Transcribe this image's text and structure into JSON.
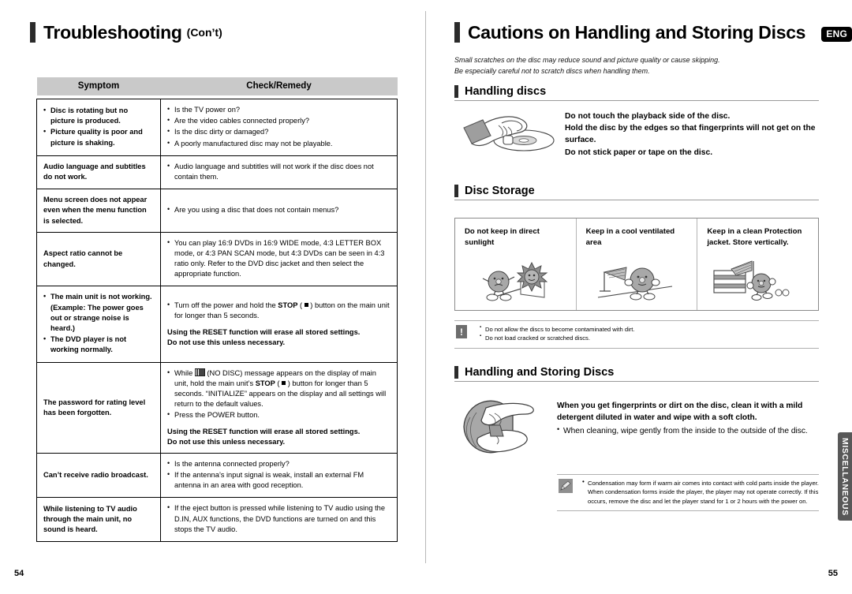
{
  "left_page": {
    "title": "Troubleshooting",
    "title_suffix": "(Con’t)",
    "page_number": "54",
    "table": {
      "headers": [
        "Symptom",
        "Check/Remedy"
      ],
      "rows": [
        {
          "symptom": [
            "Disc is rotating but no picture is produced.",
            "Picture quality is poor and picture is shaking."
          ],
          "remedy": [
            "Is the TV power on?",
            "Are the video cables connected properly?",
            "Is the disc dirty or damaged?",
            "A poorly manufactured disc may not be playable."
          ]
        },
        {
          "symptom_plain": "Audio language and subtitles do not work.",
          "remedy": [
            "Audio language and subtitles will not work if the disc does not contain them."
          ]
        },
        {
          "symptom_plain": "Menu screen does not appear even when the menu function is selected.",
          "remedy": [
            "Are you using a disc that does not contain menus?"
          ]
        },
        {
          "symptom_plain": "Aspect ratio cannot be changed.",
          "remedy": [
            "You can play 16:9 DVDs in 16:9 WIDE mode, 4:3 LETTER BOX mode, or 4:3 PAN SCAN mode, but 4:3 DVDs can be seen in 4:3 ratio only. Refer to the DVD disc jacket and then select the appropriate function."
          ]
        },
        {
          "symptom": [
            "The main unit is not working. (Example: The power goes out or strange noise is heard.)",
            "The DVD player is not working normally."
          ],
          "remedy_rich": {
            "bullet_pre": "Turn off the power and hold the ",
            "bullet_strong": "STOP",
            "bullet_post": " ) button on the main unit for longer than 5 seconds.",
            "note_line1": "Using the RESET function will erase all stored settings.",
            "note_line2": "Do not use this unless necessary."
          }
        },
        {
          "symptom_plain": "The password for rating level has been forgotten.",
          "remedy_rich2": {
            "b1_pre": "While ",
            "b1_mid": " (NO DISC) message appears on the display of main unit, hold the main unit’s ",
            "b1_strong": "STOP",
            "b1_post": " ) button for longer than 5 seconds. “INITIALIZE” appears on the display and all settings will return to the default values.",
            "b2": "Press the POWER button.",
            "note_line1": "Using the RESET function will erase all stored settings.",
            "note_line2": "Do not use this unless necessary."
          }
        },
        {
          "symptom_plain": "Can’t receive radio broadcast.",
          "remedy": [
            "Is the antenna connected properly?",
            "If the antenna’s input signal is weak, install an external FM antenna in an area with good reception."
          ]
        },
        {
          "symptom_plain": "While listening to TV audio through the main unit, no sound is heard.",
          "remedy": [
            "If the eject button is pressed while listening to TV audio using the D.IN, AUX functions, the DVD functions are turned on and this stops the TV audio."
          ]
        }
      ]
    }
  },
  "right_page": {
    "title": "Cautions on Handling and Storing Discs",
    "lang_badge": "ENG",
    "side_tab": "MISCELLANEOUS",
    "page_number": "55",
    "intro": [
      "Small scratches on the disc may reduce sound and picture quality or cause skipping.",
      "Be especially careful not to scratch discs when handling them."
    ],
    "handling_discs": {
      "heading": "Handling discs",
      "lines": [
        "Do not touch the playback side of the disc.",
        "Hold the disc by the edges so that fingerprints will not get on the surface.",
        "Do not stick paper or tape on the disc."
      ],
      "art_name": "hand-holding-disc-illustration"
    },
    "disc_storage": {
      "heading": "Disc Storage",
      "columns": [
        {
          "caption": "Do not keep in direct sunlight",
          "art_name": "disc-character-sunlight-illustration"
        },
        {
          "caption": "Keep in a cool ventilated area",
          "art_name": "disc-character-fan-illustration"
        },
        {
          "caption": "Keep in a clean Protection jacket. Store vertically.",
          "art_name": "disc-character-shelf-illustration"
        }
      ],
      "caution": [
        "Do not allow the discs to become contaminated with dirt.",
        "Do not load cracked or scratched discs."
      ]
    },
    "handling_storing": {
      "heading": "Handling and Storing Discs",
      "bold_text": "When you get fingerprints or dirt on the disc, clean it with a mild detergent diluted in water and wipe with a soft cloth.",
      "bullets": [
        "When cleaning, wipe gently from the inside to the outside of the disc."
      ],
      "art_name": "hands-cleaning-disc-illustration",
      "note": "Condensation may form if warm air comes into contact with cold parts inside the player. When condensation forms inside the player, the player may not operate correctly. If this occurs, remove the disc and let the player stand for 1 or 2 hours with the power on."
    }
  }
}
